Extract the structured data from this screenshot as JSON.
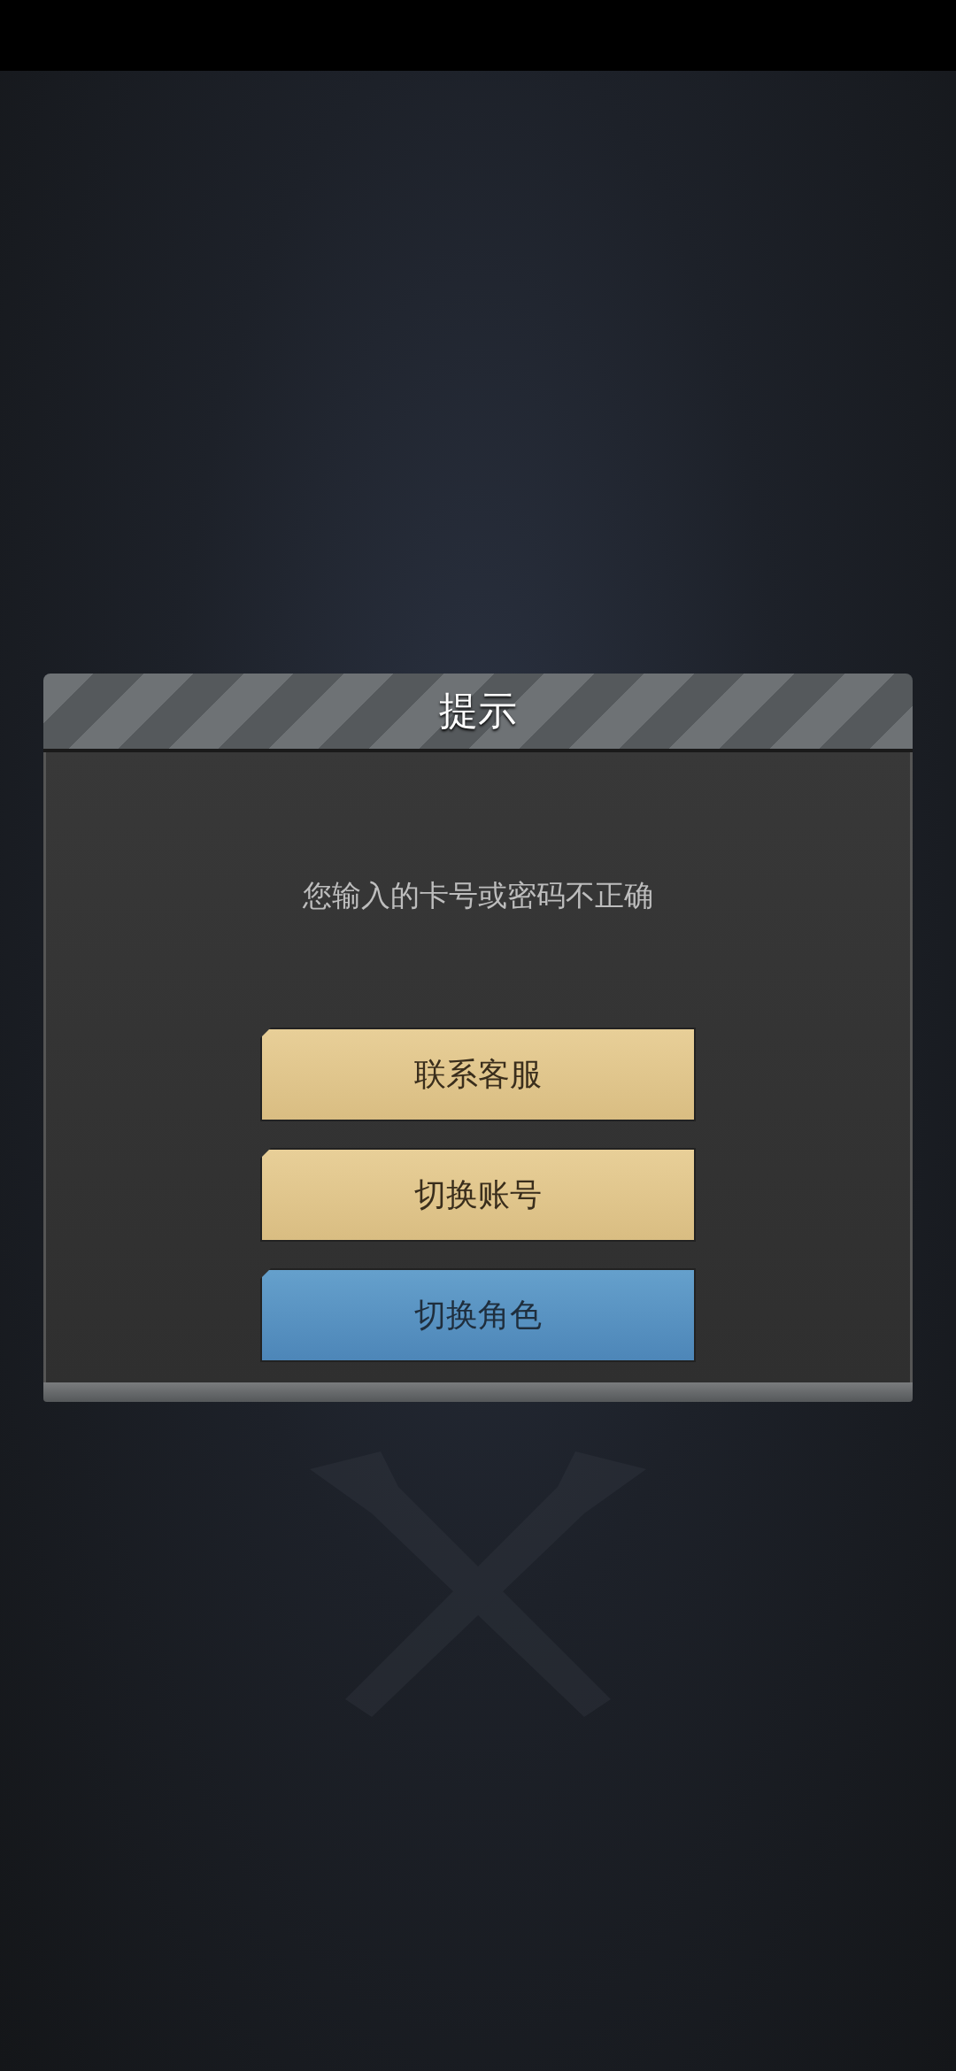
{
  "dialog": {
    "title": "提示",
    "message": "您输入的卡号或密码不正确",
    "buttons": [
      {
        "label": "联系客服",
        "kind": "secondary"
      },
      {
        "label": "切换账号",
        "kind": "secondary"
      },
      {
        "label": "切换角色",
        "kind": "primary"
      }
    ]
  }
}
